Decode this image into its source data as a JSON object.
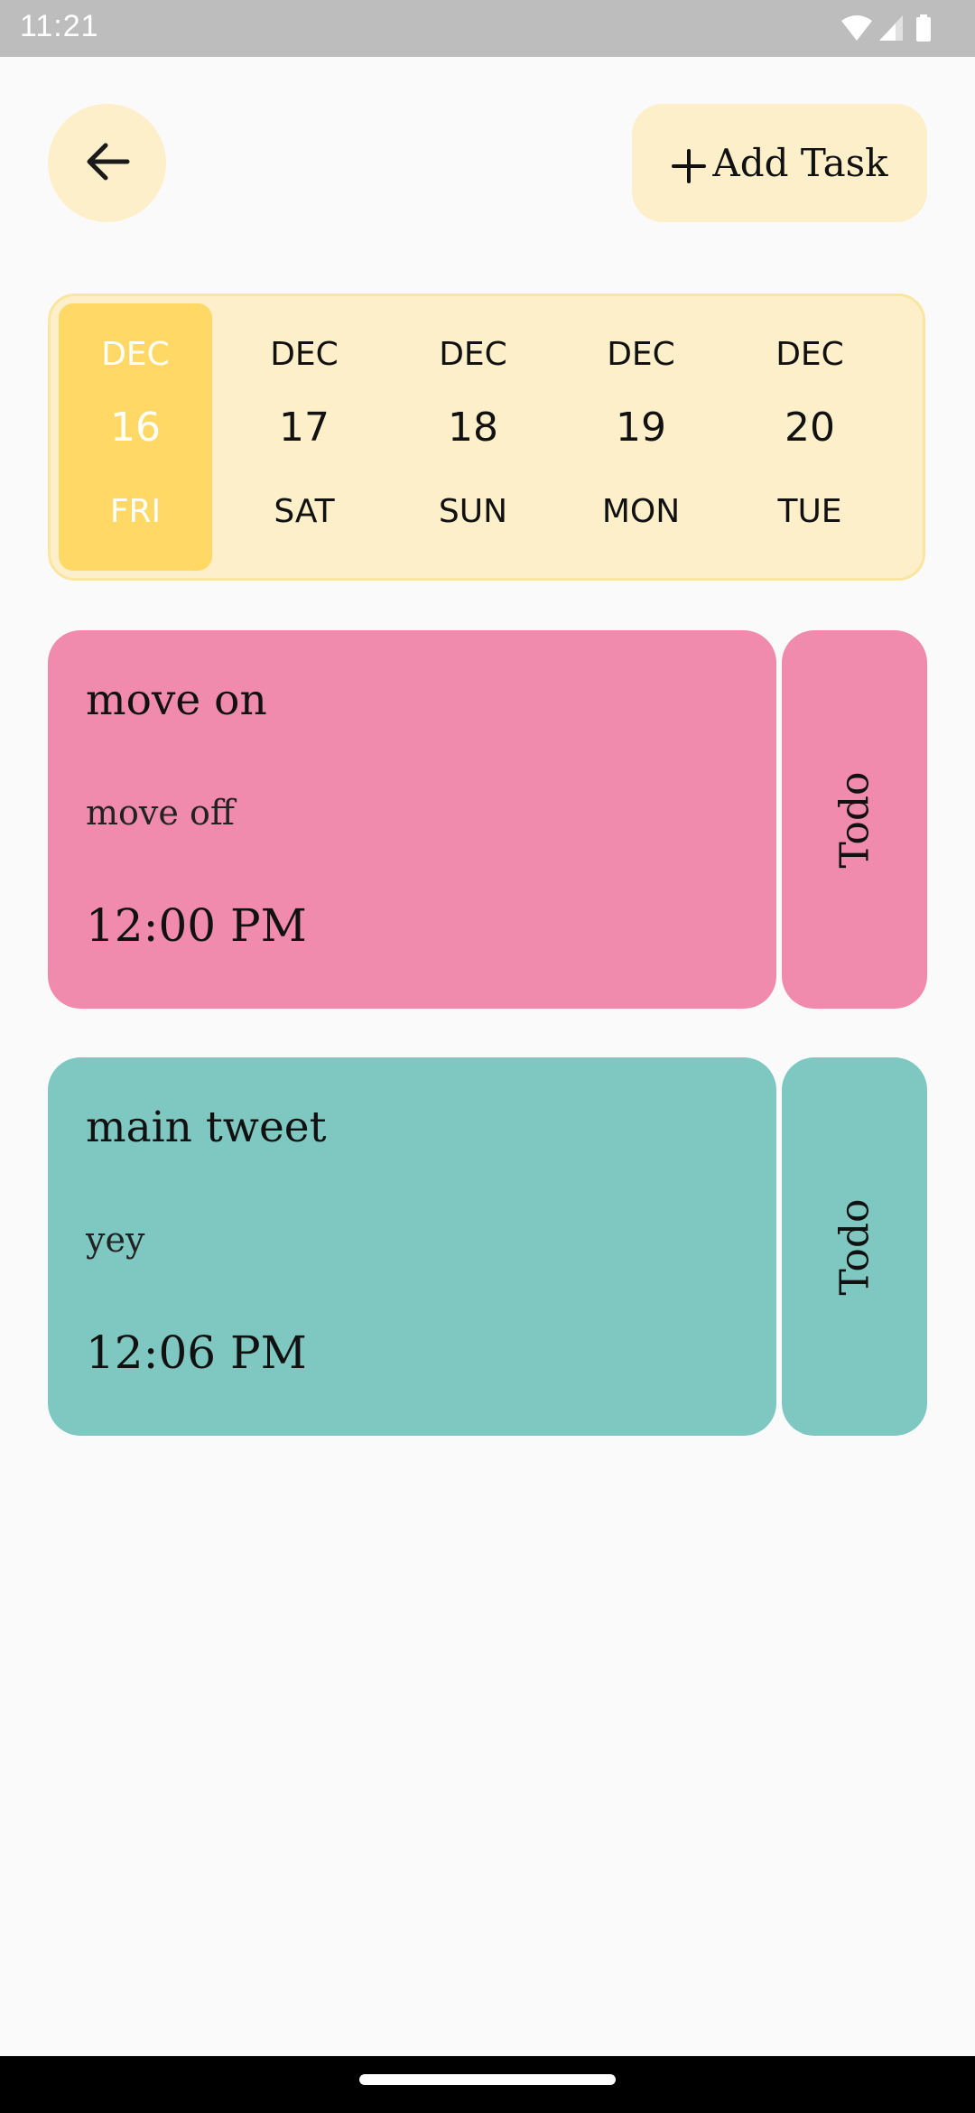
{
  "status_bar": {
    "time": "11:21",
    "icons": [
      "wifi-icon",
      "cell-signal-icon",
      "battery-icon"
    ]
  },
  "header": {
    "back_icon": "arrow-left-icon",
    "add_task_icon": "plus-icon",
    "add_task_label": "Add Task"
  },
  "date_strip": {
    "selected_index": 0,
    "dates": [
      {
        "month": "DEC",
        "day": "16",
        "weekday": "FRI"
      },
      {
        "month": "DEC",
        "day": "17",
        "weekday": "SAT"
      },
      {
        "month": "DEC",
        "day": "18",
        "weekday": "SUN"
      },
      {
        "month": "DEC",
        "day": "19",
        "weekday": "MON"
      },
      {
        "month": "DEC",
        "day": "20",
        "weekday": "TUE"
      }
    ]
  },
  "tasks": [
    {
      "title": "move on",
      "note": "move off",
      "time": "12:00 PM",
      "status": "Todo",
      "color": "#f08bad"
    },
    {
      "title": "main tweet",
      "note": "yey",
      "time": "12:06 PM",
      "status": "Todo",
      "color": "#7fc8c1"
    }
  ],
  "colors": {
    "background": "#fafafa",
    "accent_light": "#fcefca",
    "accent_selected": "#ffd866"
  }
}
